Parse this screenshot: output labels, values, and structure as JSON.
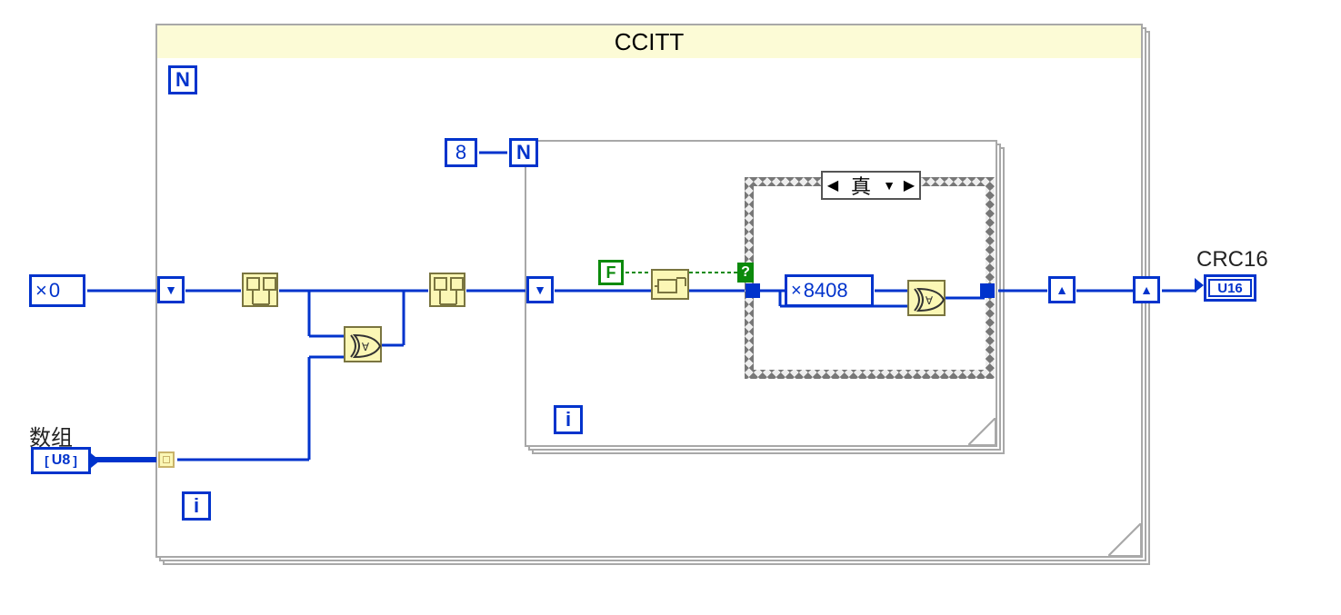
{
  "outer_frame": {
    "title": "CCITT",
    "n_terminal": "N",
    "i_terminal": "i"
  },
  "inner_loop": {
    "count_constant": "8",
    "n_terminal": "N",
    "i_terminal": "i",
    "bool_constant": "F"
  },
  "case_structure": {
    "selector_label": "真",
    "selector_question": "?",
    "xor_constant": "8408",
    "xor_prefix": "×"
  },
  "inputs": {
    "initial_prefix": "×",
    "initial_value": "0",
    "array_label": "数组",
    "array_type": "U8"
  },
  "output": {
    "label": "CRC16",
    "type": "U16"
  },
  "glyphs": {
    "down_triangle": "▼",
    "up_triangle": "▲",
    "left_triangle": "◀",
    "split_icon": "⎄"
  }
}
